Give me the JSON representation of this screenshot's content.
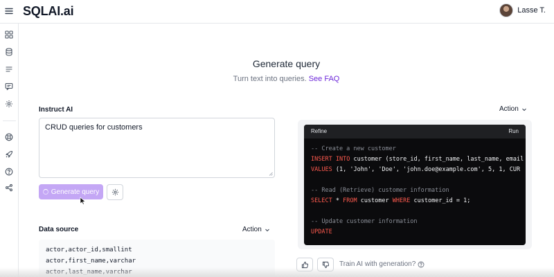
{
  "app": {
    "logo": "SQLAI.ai"
  },
  "user": {
    "name": "Lasse T."
  },
  "header": {
    "title": "Generate query",
    "subtitle": "Turn text into queries.",
    "faq_link": "See FAQ"
  },
  "instruct": {
    "label": "Instruct AI",
    "prompt_value": "CRUD queries for customers",
    "generate_button": "Generate query"
  },
  "output": {
    "action_label": "Action",
    "tabs": {
      "refine": "Refine",
      "run": "Run"
    },
    "code_lines": [
      "-- Create a new customer",
      "INSERT INTO customer (store_id, first_name, last_name, email",
      "VALUES (1, 'John', 'Doe', 'john.doe@example.com', 5, 1, CUR",
      "",
      "-- Read (Retrieve) customer information",
      "SELECT * FROM customer WHERE customer_id = 1;",
      "",
      "-- Update customer information",
      "UPDATE"
    ]
  },
  "data_source": {
    "label": "Data source",
    "action_label": "Action",
    "rows": [
      "actor,actor_id,smallint",
      "actor,first_name,varchar",
      "actor,last_name,varchar"
    ]
  },
  "feedback": {
    "text": "Train AI with generation?"
  },
  "sidebar": {
    "icons": [
      "dashboard-icon",
      "database-icon",
      "list-icon",
      "chat-icon",
      "gear-icon",
      "support-icon",
      "rocket-icon",
      "help-icon",
      "share-icon"
    ]
  },
  "colors": {
    "accent": "#6d28d9",
    "button": "#c4a7f5",
    "code_bg": "#0b0b0d",
    "keyword": "#ff5a4e",
    "comment": "#8b8f98"
  }
}
